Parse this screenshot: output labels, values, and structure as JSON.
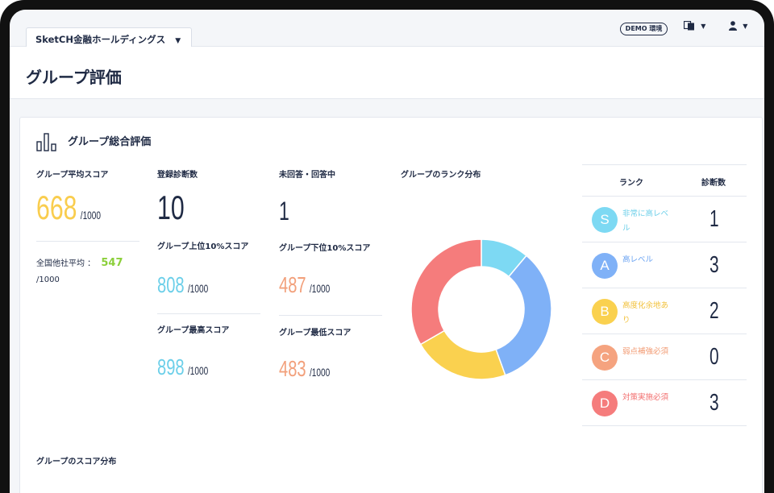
{
  "header": {
    "company": "SketCH金融ホールディングス",
    "demo_badge": "DEMO 環境"
  },
  "page": {
    "title": "グループ評価"
  },
  "overview": {
    "title": "グループ総合評価",
    "avg_score": {
      "label": "グループ平均スコア",
      "value": "668",
      "unit": "/1000"
    },
    "national_avg": {
      "label": "全国他社平均 ：",
      "value": "547",
      "unit": "/1000"
    },
    "registered": {
      "label": "登録診断数",
      "value": "10"
    },
    "unanswered": {
      "label": "未回答・回答中",
      "value": "1"
    },
    "top10": {
      "label": "グループ上位10%スコア",
      "value": "808",
      "unit": "/1000"
    },
    "bottom10": {
      "label": "グループ下位10%スコア",
      "value": "487",
      "unit": "/1000"
    },
    "max": {
      "label": "グループ最高スコア",
      "value": "898",
      "unit": "/1000"
    },
    "min": {
      "label": "グループ最低スコア",
      "value": "483",
      "unit": "/1000"
    },
    "distribution_title": "グループのランク分布",
    "score_distribution_title": "グループのスコア分布"
  },
  "rank_table": {
    "headers": [
      "ランク",
      "診断数"
    ],
    "rows": [
      {
        "rank": "S",
        "label": "非常に高レベル",
        "count": "1",
        "color": "#7dd9f3",
        "text_color": "#6ccfe9"
      },
      {
        "rank": "A",
        "label": "高レベル",
        "count": "3",
        "color": "#7fb1f7",
        "text_color": "#6ba3f2"
      },
      {
        "rank": "B",
        "label": "高度化余地あり",
        "count": "2",
        "color": "#fad14f",
        "text_color": "#f2c13a"
      },
      {
        "rank": "C",
        "label": "弱点補強必須",
        "count": "0",
        "color": "#f5a37f",
        "text_color": "#f29b73"
      },
      {
        "rank": "D",
        "label": "対策実施必須",
        "count": "3",
        "color": "#f57c7c",
        "text_color": "#f26e6e"
      }
    ]
  },
  "chart_data": {
    "type": "pie",
    "categories": [
      "S",
      "A",
      "B",
      "C",
      "D"
    ],
    "values": [
      1,
      3,
      2,
      0,
      3
    ],
    "colors": [
      "#7dd9f3",
      "#7fb1f7",
      "#fad14f",
      "#f5a37f",
      "#f57c7c"
    ]
  }
}
